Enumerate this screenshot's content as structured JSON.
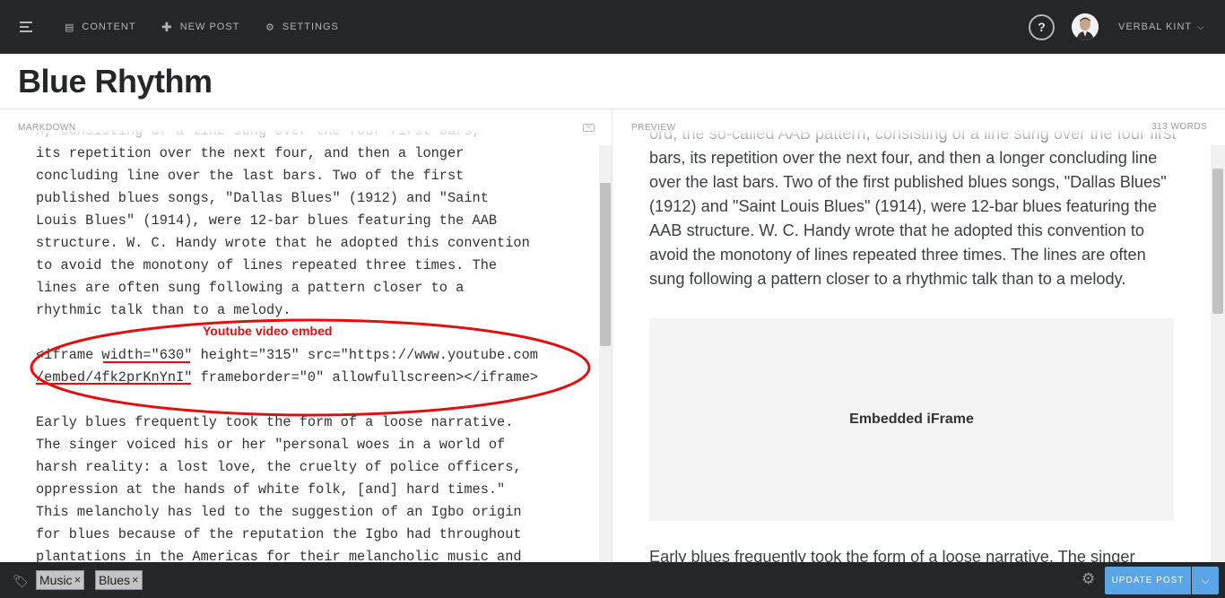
{
  "nav": {
    "items": [
      {
        "label": "CONTENT",
        "icon": "content-icon"
      },
      {
        "label": "NEW POST",
        "icon": "plus-icon"
      },
      {
        "label": "SETTINGS",
        "icon": "settings-icon"
      }
    ],
    "help": "?",
    "user": "VERBAL KINT"
  },
  "post": {
    "title": "Blue Rhythm"
  },
  "markdown": {
    "header": "MARKDOWN",
    "lines": [
      "n, consisting of a line sung over the four first bars,",
      "its repetition over the next four, and then a longer",
      "concluding line over the last bars. Two of the first",
      "published blues songs, \"Dallas Blues\" (1912) and \"Saint",
      "Louis Blues\" (1914), were 12-bar blues featuring the AAB",
      "structure. W. C. Handy wrote that he adopted this convention",
      "to avoid the monotony of lines repeated three times. The",
      "lines are often sung following a pattern closer to a",
      "rhythmic talk than to a melody.",
      "",
      "<iframe width=\"630\" height=\"315\" src=\"https://www.youtube.com",
      "/embed/4fk2prKnYnI\" frameborder=\"0\" allowfullscreen></iframe>",
      "",
      "Early blues frequently took the form of a loose narrative.",
      "The singer voiced his or her \"personal woes in a world of",
      "harsh reality: a lost love, the cruelty of police officers,",
      "oppression at the hands of white folk, [and] hard times.\"",
      "This melancholy has led to the suggestion of an Igbo origin",
      "for blues because of the reputation the Igbo had throughout",
      "plantations in the Americas for their melancholic music and"
    ]
  },
  "preview": {
    "header": "PREVIEW",
    "word_count": "313 WORDS",
    "para1": "ord, the so-called AAB pattern, consisting of a line sung over the four first bars, its repetition over the next four, and then a longer concluding line over the last bars. Two of the first published blues songs, \"Dallas Blues\" (1912) and \"Saint Louis Blues\" (1914), were 12-bar blues featuring the AAB structure. W. C. Handy wrote that he adopted this convention to avoid the monotony of lines repeated three times. The lines are often sung following a pattern closer to a rhythmic talk than to a melody.",
    "iframe_placeholder": "Embedded iFrame",
    "para2": "Early blues frequently took the form of a loose narrative. The singer"
  },
  "annotation": {
    "label": "Youtube video embed",
    "color": "#e01010"
  },
  "footer": {
    "tags": [
      "Music",
      "Blues"
    ],
    "tag_remove": "×",
    "update_button": "UPDATE POST",
    "accent": "#5ba4e5"
  }
}
